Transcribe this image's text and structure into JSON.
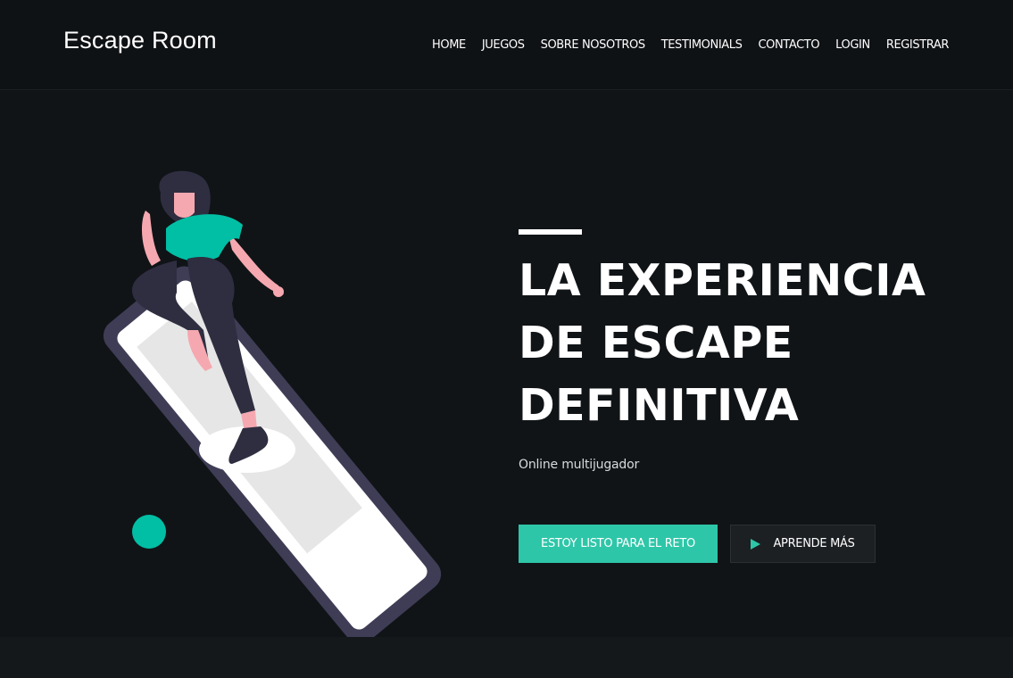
{
  "brand": {
    "name": "Escape Room"
  },
  "nav": {
    "items": [
      {
        "label": "HOME"
      },
      {
        "label": "JUEGOS"
      },
      {
        "label": "SOBRE NOSOTROS"
      },
      {
        "label": "TESTIMONIALS"
      },
      {
        "label": "CONTACTO"
      },
      {
        "label": "LOGIN"
      },
      {
        "label": "REGISTRAR"
      }
    ]
  },
  "hero": {
    "title_lines": [
      "LA EXPERIENCIA",
      "DE ESCAPE",
      "DEFINITIVA"
    ],
    "subtitle": "Online multijugador",
    "primary_button": "ESTOY LISTO PARA EL RETO",
    "secondary_button": "APRENDE MÁS"
  },
  "colors": {
    "accent": "#2ec6a8",
    "background": "#101417",
    "phone_frame": "#3f3d56"
  },
  "icons": {
    "secondary_button_icon": "play-icon"
  }
}
